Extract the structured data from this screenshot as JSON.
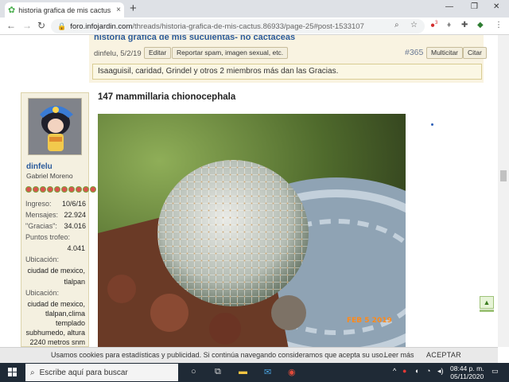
{
  "browser": {
    "tab_title": "historia grafica de mis cactus | Fo",
    "tab_close": "×",
    "new_tab": "+",
    "url_host": "foro.infojardin.com",
    "url_path": "/threads/historia-grafica-de-mis-cactus.86933/page-25#post-1533107",
    "ext_badge": "3"
  },
  "prev_post": {
    "title": "historia grafica de mis suculentas- no cactaceas",
    "meta": "dinfelu, 5/2/19",
    "edit_label": "Editar",
    "report_label": "Reportar spam, imagen sexual, etc.",
    "post_number": "#365",
    "multiquote_label": "Multicitar",
    "quote_label": "Citar",
    "thanks_text": "Isaaguisil, caridad, Grindel y otros 2 miembros más dan las Gracias."
  },
  "user": {
    "name": "dinfelu",
    "real_name": "Gabriel Moreno",
    "stars": 10,
    "stats": [
      {
        "label": "Ingreso:",
        "value": "10/6/16"
      },
      {
        "label": "Mensajes:",
        "value": "22.924"
      },
      {
        "label": "\"Gracias\":",
        "value": "34.016"
      }
    ],
    "trophy_label": "Puntos trofeo:",
    "trophy_value": "4.041",
    "location_label": "Ubicación:",
    "location_line1": "ciudad de mexico,",
    "location_line2": "tlalpan",
    "location2_label": "Ubicación:",
    "location2_lines": [
      "ciudad de mexico,",
      "tlalpan,clima",
      "templado",
      "subhumedo, altura",
      "2240 metros snm"
    ]
  },
  "post": {
    "title": "147 mammillaria chionocephala",
    "photo_stamp": "FEB 5 2019"
  },
  "cookie": {
    "message": "Usamos cookies para estadísticas y publicidad. Si continúa navegando consideramos que acepta su uso.",
    "more": "Leer más",
    "accept": "ACEPTAR"
  },
  "taskbar": {
    "search_placeholder": "Escribe aquí para buscar",
    "time": "08:44 p. m.",
    "date": "05/11/2020"
  }
}
